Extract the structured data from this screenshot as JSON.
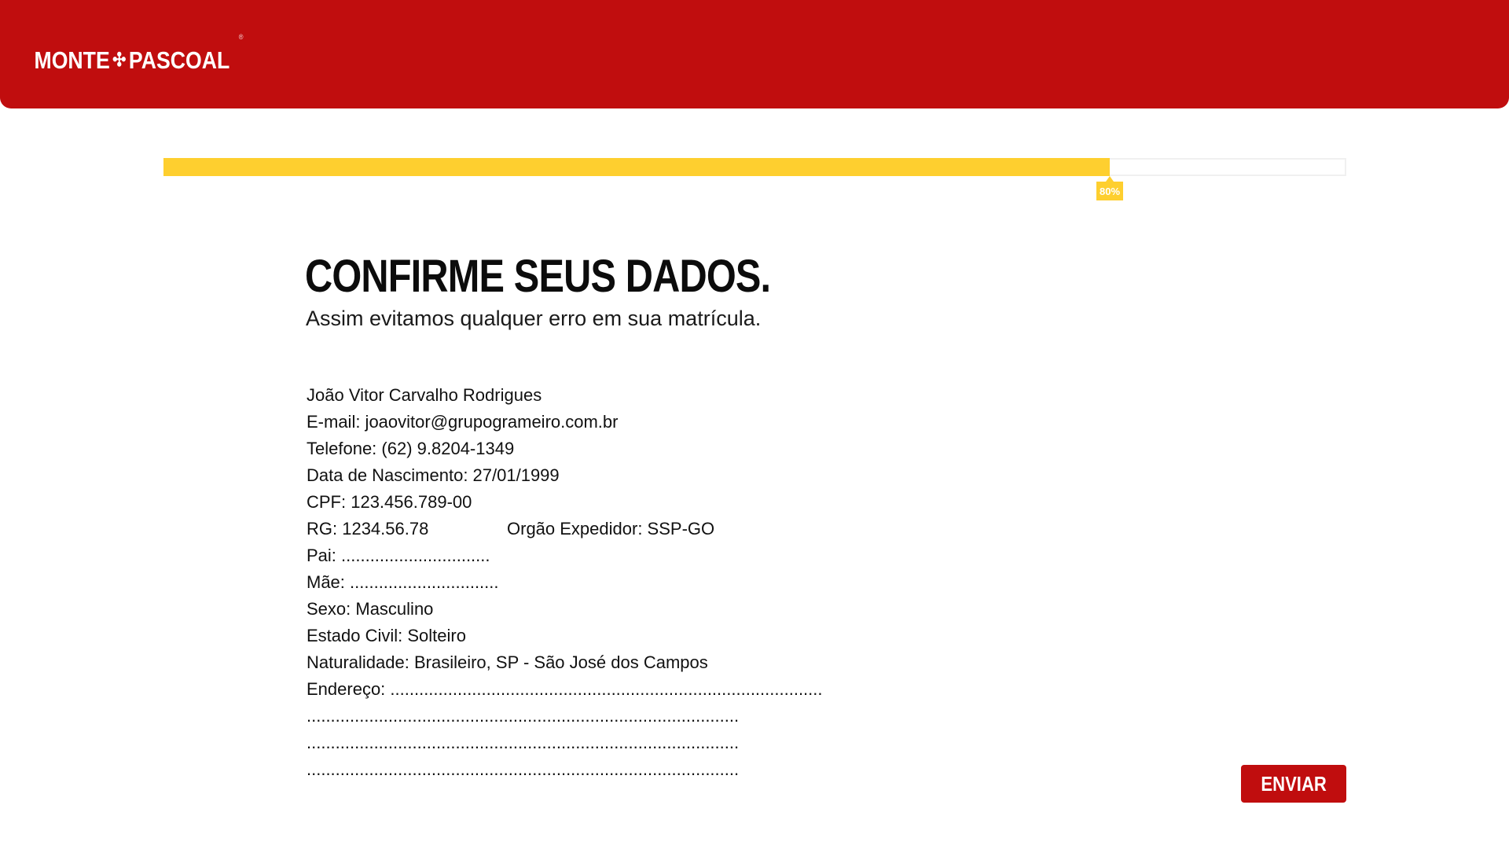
{
  "header": {
    "logo": {
      "left_text": "MONTE",
      "cross_glyph": "✣",
      "right_text": "PASCOAL",
      "registered_mark": "®"
    },
    "background_color": "#c00d0e"
  },
  "progress": {
    "value": 0.8,
    "label": "80%",
    "fill_color": "#fecf2f"
  },
  "main": {
    "title": "CONFIRME SEUS DADOS.",
    "subtitle": "Assim evitamos qualquer erro em sua matrícula.",
    "name": "João Vitor Carvalho Rodrigues",
    "email": "E-mail: joaovitor@grupogrameiro.com.br",
    "phone": "Telefone: (62) 9.8204-1349",
    "birth_date": "Data de Nascimento: 27/01/1999",
    "cpf": "CPF: 123.456.789-00",
    "rg": "RG: 1234.56.78",
    "issuer": "Orgão Expedidor: SSP-GO",
    "father": "Pai: ...............................",
    "mother": "Mãe: ...............................",
    "sex": "Sexo: Masculino",
    "marital_status": "Estado Civil: Solteiro",
    "birthplace": "Naturalidade: Brasileiro, SP - São José dos Campos",
    "address_line_1": "Endereço: ..........................................................................................",
    "address_line_2": "..........................................................................................",
    "address_line_3": "..........................................................................................",
    "address_line_4": ".........................................................................................."
  },
  "actions": {
    "submit_label": "ENVIAR",
    "accent_color": "#c00d0e"
  }
}
